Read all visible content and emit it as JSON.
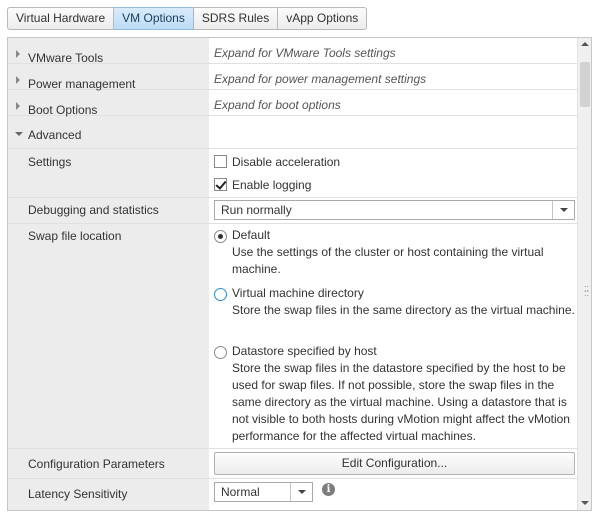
{
  "tabs": [
    {
      "label": "Virtual Hardware",
      "active": false
    },
    {
      "label": "VM Options",
      "active": true
    },
    {
      "label": "SDRS Rules",
      "active": false
    },
    {
      "label": "vApp Options",
      "active": false
    }
  ],
  "sections": {
    "vmware_tools": {
      "label": "VMware Tools",
      "hint": "Expand for VMware Tools settings"
    },
    "power_management": {
      "label": "Power management",
      "hint": "Expand for power management settings"
    },
    "boot_options": {
      "label": "Boot Options",
      "hint": "Expand for boot options"
    },
    "advanced": {
      "label": "Advanced"
    }
  },
  "settings": {
    "label": "Settings",
    "disable_acceleration": {
      "label": "Disable acceleration",
      "checked": false
    },
    "enable_logging": {
      "label": "Enable logging",
      "checked": true
    }
  },
  "debugging": {
    "label": "Debugging and statistics",
    "selected": "Run normally"
  },
  "swap": {
    "label": "Swap file location",
    "options": [
      {
        "title": "Default",
        "desc": "Use the settings of the cluster or host containing the virtual machine.",
        "selected": true
      },
      {
        "title": "Virtual machine directory",
        "desc": "Store the swap files in the same directory as the virtual machine.",
        "selected": false
      },
      {
        "title": "Datastore specified by host",
        "desc": "Store the swap files in the datastore specified by the host to be used for swap files. If not possible, store the swap files in the same directory as the virtual machine. Using a datastore that is not visible to both hosts during vMotion might affect the vMotion performance for the affected virtual machines.",
        "selected": false
      }
    ]
  },
  "config_params": {
    "label": "Configuration Parameters",
    "button_label": "Edit Configuration..."
  },
  "latency": {
    "label": "Latency Sensitivity",
    "selected": "Normal",
    "info_icon": "i"
  }
}
